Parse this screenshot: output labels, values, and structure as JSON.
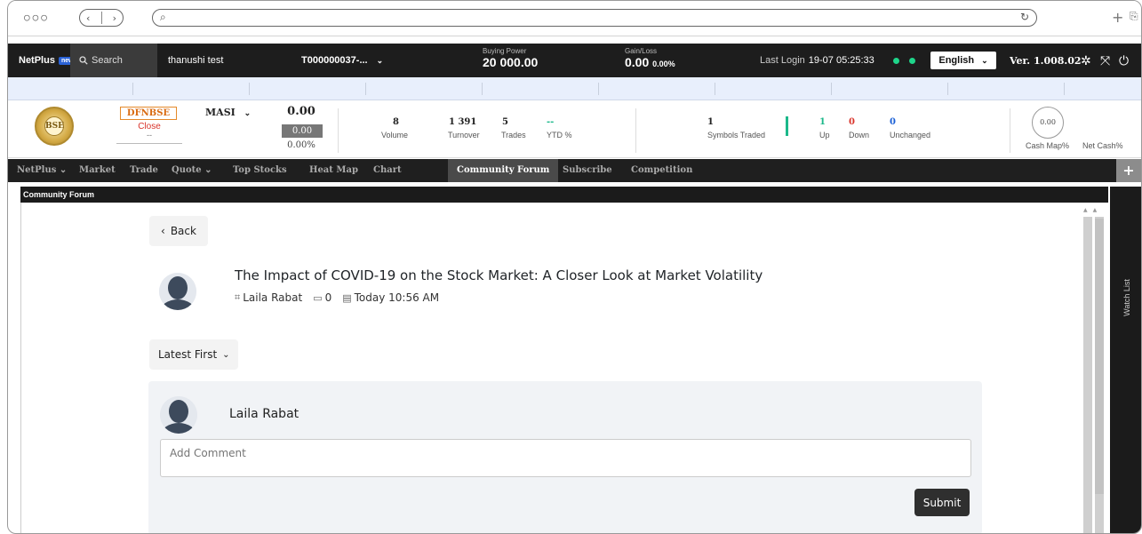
{
  "browser": {
    "dots": "○○○",
    "back": "‹",
    "forward": "›",
    "search_glyph": "⌕",
    "reload_glyph": "↻",
    "new_tab": "+",
    "share": "⎘"
  },
  "topbar": {
    "brand": "NetPlus",
    "brand_badge": "new",
    "search_label": "Search",
    "user": "thanushi test",
    "account": "T000000037-...",
    "buying_power_label": "Buying Power",
    "buying_power_value": "20 000.00",
    "gain_loss_label": "Gain/Loss",
    "gain_loss_value": "0.00",
    "gain_loss_pct": "0.00%",
    "last_login_label": "Last Login",
    "last_login_value": "19-07 05:25:33",
    "language": "English",
    "version": "Ver. 1.008.02"
  },
  "summary": {
    "logo_text": "BSE",
    "symbol": "DFNBSE",
    "status": "Close",
    "status_sub": "--",
    "index_name": "MASI",
    "index_value": "0.00",
    "index_change": "0.00",
    "index_pct": "0.00%",
    "volume": "8",
    "volume_label": "Volume",
    "turnover": "1 391",
    "turnover_label": "Turnover",
    "trades": "5",
    "trades_label": "Trades",
    "ytd": "--",
    "ytd_label": "YTD %",
    "symbols_traded": "1",
    "symbols_traded_label": "Symbols Traded",
    "up": "1",
    "up_label": "Up",
    "down": "0",
    "down_label": "Down",
    "unchanged": "0",
    "unchanged_label": "Unchanged",
    "cash_map_value": "0.00",
    "cash_map_label": "Cash Map%",
    "net_cash_label": "Net Cash%"
  },
  "nav": {
    "items": [
      "NetPlus",
      "Market",
      "Trade",
      "Quote",
      "Top Stocks",
      "Heat Map",
      "Chart",
      "Community Forum",
      "Subscribe",
      "Competition"
    ],
    "active": "Community Forum"
  },
  "panel": {
    "title": "Community Forum",
    "back_label": "Back",
    "post_title": "The Impact of COVID-19 on the Stock Market: A Closer Look at Market Volatility",
    "post_author": "Laila Rabat",
    "post_comments": "0",
    "post_time": "Today 10:56 AM",
    "sort_label": "Latest First",
    "comment_user": "Laila Rabat",
    "comment_placeholder": "Add Comment",
    "submit_label": "Submit",
    "watch_list_label": "Watch List"
  },
  "colors": {
    "topbar_bg": "#1d1d1d",
    "nav_bg": "#1f1f1f",
    "accent_green": "#1ed58a",
    "down_red": "#d9342b",
    "up_teal": "#1bb88a",
    "unchanged_blue": "#1a5fd6",
    "symbol_orange": "#d96a10"
  }
}
